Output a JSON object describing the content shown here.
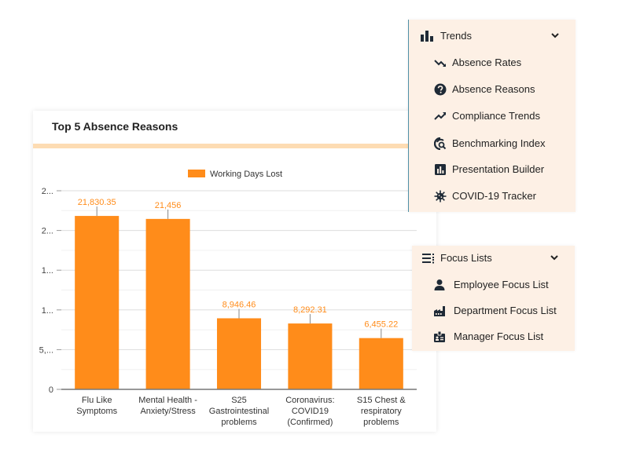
{
  "chart_card": {
    "title": "Top 5 Absence Reasons"
  },
  "chart_data": {
    "type": "bar",
    "title": "Top 5 Absence Reasons",
    "xlabel": "",
    "ylabel": "",
    "categories": [
      [
        "Flu Like",
        "Symptoms"
      ],
      [
        "Mental Health -",
        "Anxiety/Stress"
      ],
      [
        "S25",
        "Gastrointestinal",
        "problems"
      ],
      [
        "Coronavirus:",
        "COVID19",
        "(Confirmed)"
      ],
      [
        "S15 Chest &",
        "respiratory",
        "problems"
      ]
    ],
    "series": [
      {
        "name": "Working Days Lost",
        "color": "#ff8c1a",
        "values": [
          21830.35,
          21456,
          8946.46,
          8292.31,
          6455.22
        ],
        "data_labels": [
          "21,830.35",
          "21,456",
          "8,946.46",
          "8,292.31",
          "6,455.22"
        ]
      }
    ],
    "ylim": [
      0,
      25000
    ],
    "yticks": [
      0,
      5000,
      10000,
      15000,
      20000,
      25000
    ],
    "ytick_labels": [
      "0",
      "5,...",
      "1...",
      "1...",
      "2...",
      "2..."
    ],
    "minor_gridlines": true,
    "grid": true,
    "legend": "top-center",
    "label_color": "#ff8c1a"
  },
  "trends_menu": {
    "header": {
      "label": "Trends",
      "icon": "bar-chart-icon",
      "expanded": true
    },
    "items": [
      {
        "label": "Absence Rates",
        "icon": "trend-down-icon"
      },
      {
        "label": "Absence Reasons",
        "icon": "question-circle-icon"
      },
      {
        "label": "Compliance Trends",
        "icon": "trend-up-icon"
      },
      {
        "label": "Benchmarking Index",
        "icon": "benchmark-search-icon"
      },
      {
        "label": "Presentation Builder",
        "icon": "presentation-chart-icon"
      },
      {
        "label": "COVID-19 Tracker",
        "icon": "virus-icon"
      }
    ]
  },
  "focus_menu": {
    "header": {
      "label": "Focus Lists",
      "icon": "list-icon",
      "expanded": true
    },
    "items": [
      {
        "label": "Employee Focus List",
        "icon": "user-icon"
      },
      {
        "label": "Department Focus List",
        "icon": "industry-icon"
      },
      {
        "label": "Manager Focus List",
        "icon": "id-badge-icon"
      }
    ]
  }
}
